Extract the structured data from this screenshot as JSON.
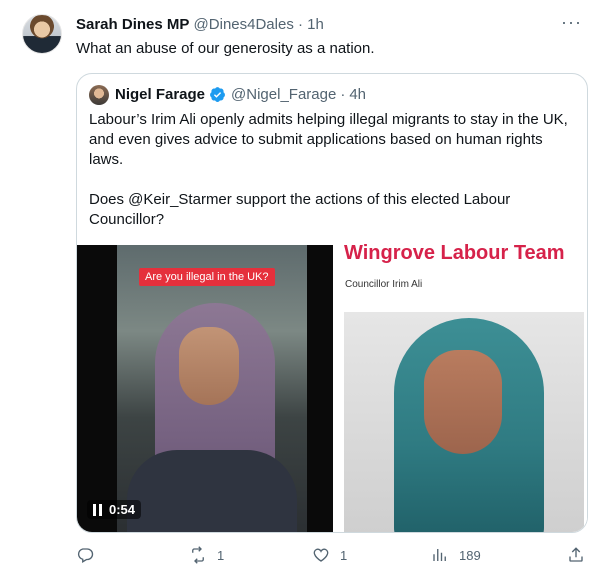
{
  "tweet": {
    "author_name": "Sarah Dines MP",
    "author_handle": "@Dines4Dales",
    "separator": "·",
    "time": "1h",
    "more": "···",
    "text": "What an abuse of our generosity as a nation."
  },
  "quoted": {
    "author_name": "Nigel Farage",
    "author_handle": "@Nigel_Farage",
    "separator": "·",
    "time": "4h",
    "paragraph1": "Labour’s Irim Ali openly admits helping illegal migrants to stay in the UK, and even gives advice to submit applications based on human rights laws.",
    "paragraph2": "Does @Keir_Starmer support the actions of this elected Labour Councillor?",
    "video": {
      "caption": "Are you illegal in the UK?",
      "duration": "0:54"
    },
    "card": {
      "title": "Wingrove Labour Team",
      "subtitle": "Councillor Irim Ali"
    }
  },
  "actions": {
    "reply_count": "",
    "retweet_count": "1",
    "like_count": "1",
    "views_count": "189"
  },
  "colors": {
    "text": "#0f1419",
    "muted": "#536471",
    "verified": "#1d9bf0",
    "card_title": "#d6224a"
  },
  "icons": [
    "more-icon",
    "verified-icon",
    "play-pause-icon",
    "reply-icon",
    "retweet-icon",
    "like-icon",
    "views-icon",
    "share-icon"
  ]
}
